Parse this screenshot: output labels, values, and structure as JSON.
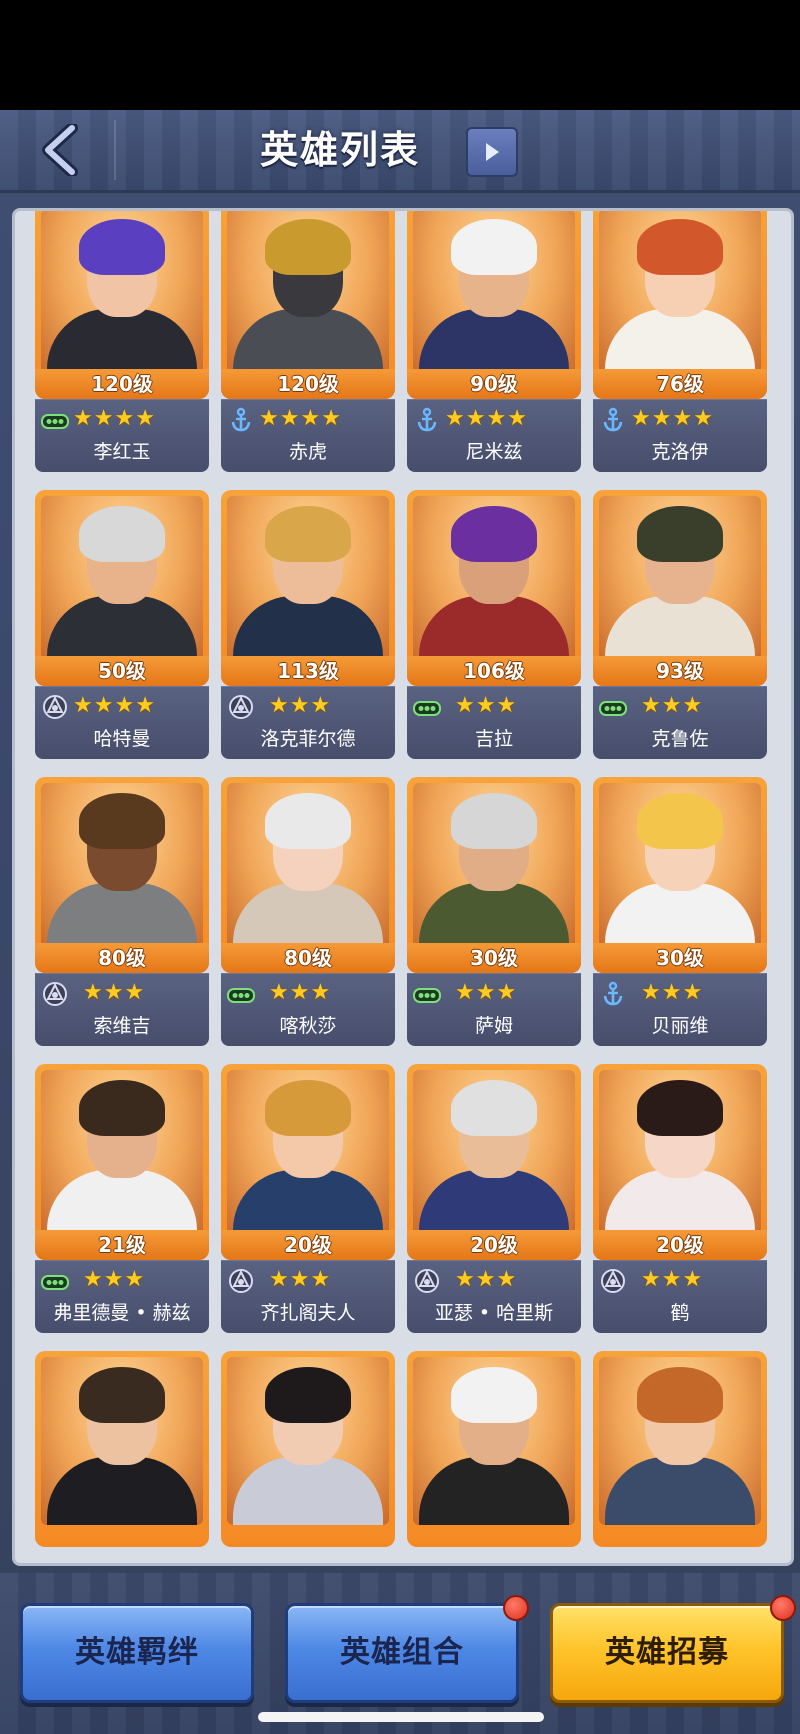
{
  "header": {
    "title": "英雄列表"
  },
  "heroes": [
    {
      "level": "120级",
      "name": "李红玉",
      "stars": 4,
      "class": "tank",
      "colors": {
        "hair": "#5a3fc0",
        "skin": "#f1c4a6",
        "body": "#2a2a33"
      }
    },
    {
      "level": "120级",
      "name": "赤虎",
      "stars": 4,
      "class": "navy",
      "colors": {
        "hair": "#c99a2e",
        "skin": "#3a3a3e",
        "body": "#4b4d55"
      }
    },
    {
      "level": "90级",
      "name": "尼米兹",
      "stars": 4,
      "class": "navy",
      "colors": {
        "hair": "#f2f2f2",
        "skin": "#e7b38a",
        "body": "#2c3566"
      }
    },
    {
      "level": "76级",
      "name": "克洛伊",
      "stars": 4,
      "class": "navy",
      "colors": {
        "hair": "#d2572a",
        "skin": "#f7cfb3",
        "body": "#f4f0ea"
      }
    },
    {
      "level": "50级",
      "name": "哈特曼",
      "stars": 4,
      "class": "air",
      "colors": {
        "hair": "#d8d8d8",
        "skin": "#e8b38b",
        "body": "#2c2f36"
      }
    },
    {
      "level": "113级",
      "name": "洛克菲尔德",
      "stars": 3,
      "class": "air",
      "colors": {
        "hair": "#d9a64a",
        "skin": "#edbd99",
        "body": "#233049"
      }
    },
    {
      "level": "106级",
      "name": "吉拉",
      "stars": 3,
      "class": "tank",
      "colors": {
        "hair": "#6b2fa0",
        "skin": "#d9a07a",
        "body": "#9b2b2b"
      }
    },
    {
      "level": "93级",
      "name": "克鲁佐",
      "stars": 3,
      "class": "tank",
      "colors": {
        "hair": "#3a3f2c",
        "skin": "#e7b38e",
        "body": "#e9e2d4"
      }
    },
    {
      "level": "80级",
      "name": "索维吉",
      "stars": 3,
      "class": "air",
      "colors": {
        "hair": "#5a3a1e",
        "skin": "#7a4b2e",
        "body": "#7d7e80"
      }
    },
    {
      "level": "80级",
      "name": "喀秋莎",
      "stars": 3,
      "class": "tank",
      "colors": {
        "hair": "#e9e9e9",
        "skin": "#f4d2bd",
        "body": "#d6c8b8"
      }
    },
    {
      "level": "30级",
      "name": "萨姆",
      "stars": 3,
      "class": "tank",
      "colors": {
        "hair": "#d6d6d6",
        "skin": "#e1ad86",
        "body": "#4b5a30"
      }
    },
    {
      "level": "30级",
      "name": "贝丽维",
      "stars": 3,
      "class": "navy",
      "colors": {
        "hair": "#f3c64b",
        "skin": "#f6d2b9",
        "body": "#f2f2f2"
      }
    },
    {
      "level": "21级",
      "name": "弗里德曼 • 赫兹",
      "stars": 3,
      "class": "tank",
      "colors": {
        "hair": "#3a2a1e",
        "skin": "#e4b18c",
        "body": "#f0f0f0"
      }
    },
    {
      "level": "20级",
      "name": "齐扎阁夫人",
      "stars": 3,
      "class": "air",
      "colors": {
        "hair": "#d69a3a",
        "skin": "#f4c9a9",
        "body": "#27406b"
      }
    },
    {
      "level": "20级",
      "name": "亚瑟 • 哈里斯",
      "stars": 3,
      "class": "air",
      "colors": {
        "hair": "#e0e0e0",
        "skin": "#e8bd98",
        "body": "#2f3b78"
      }
    },
    {
      "level": "20级",
      "name": "鹤",
      "stars": 3,
      "class": "air",
      "colors": {
        "hair": "#2a1a18",
        "skin": "#f6d7c7",
        "body": "#f2eaea"
      }
    },
    {
      "colors": {
        "hair": "#3a2b20",
        "skin": "#edc2a0",
        "body": "#1d1d22"
      }
    },
    {
      "colors": {
        "hair": "#1e1a1c",
        "skin": "#f1cbb2",
        "body": "#c9ccd6"
      }
    },
    {
      "colors": {
        "hair": "#f2f2f2",
        "skin": "#e3af88",
        "body": "#232323"
      }
    },
    {
      "colors": {
        "hair": "#c4682a",
        "skin": "#f2c7a6",
        "body": "#3b4b6a"
      }
    }
  ],
  "buttons": {
    "bond": "英雄羁绊",
    "combo": "英雄组合",
    "recruit": "英雄招募"
  }
}
